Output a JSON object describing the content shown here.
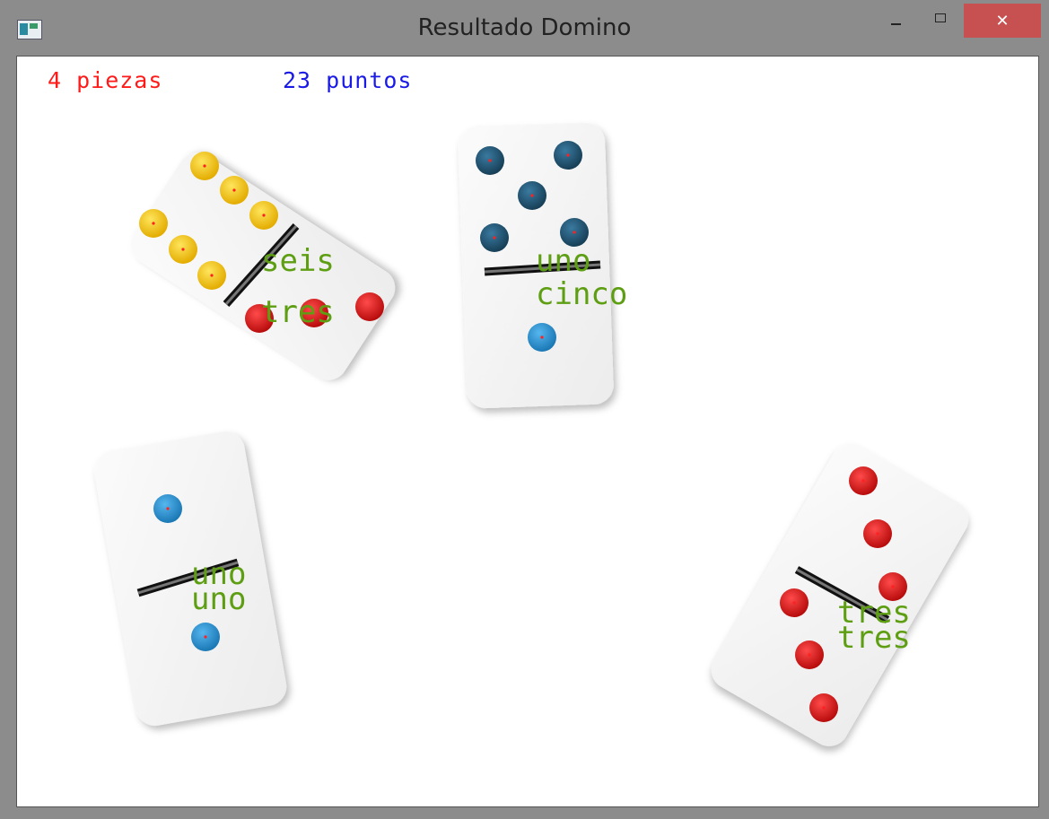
{
  "window": {
    "title": "Resultado Domino",
    "controls": {
      "minimize": "—",
      "maximize": "☐",
      "close": "✕"
    },
    "icon": "app-window-icon"
  },
  "summary": {
    "pieces": "4 piezas",
    "points": "23 puntos"
  },
  "colors": {
    "pieces_text": "#ff1a1a",
    "points_text": "#1a1ae6",
    "label_text": "#5e9e12",
    "close_button": "#c75050",
    "pip_yellow": "#f4c20d",
    "pip_red": "#d81818",
    "pip_dark_blue": "#255775",
    "pip_light_blue": "#2a93d4"
  },
  "dominoes": [
    {
      "top_label": "seis",
      "bottom_label": "tres"
    },
    {
      "top_label": "uno",
      "bottom_label": "cinco"
    },
    {
      "top_label": "uno",
      "bottom_label": "uno"
    },
    {
      "top_label": "tres",
      "bottom_label": "tres"
    }
  ]
}
